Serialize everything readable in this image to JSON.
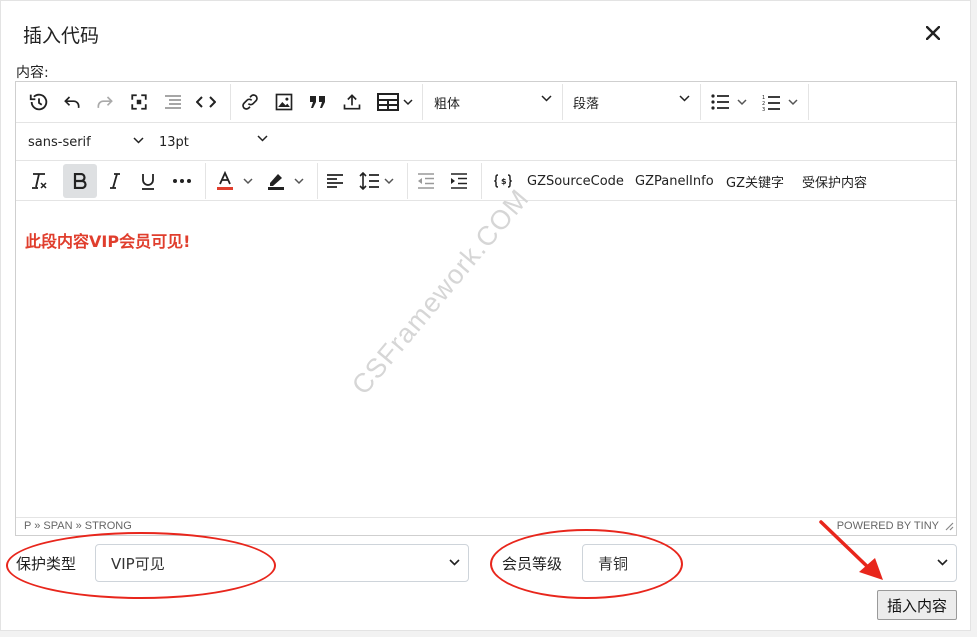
{
  "dialog": {
    "title": "插入代码",
    "close_icon": "close-icon"
  },
  "content_label": "内容:",
  "toolbar": {
    "row1": {
      "icons": [
        "history-icon",
        "undo-icon",
        "redo-icon",
        "fullscreen-icon",
        "indent-list-icon",
        "code-icon",
        "link-icon",
        "image-icon",
        "quote-icon",
        "upload-icon",
        "table-icon"
      ],
      "font_weight_select": "粗体",
      "block_format_select": "段落",
      "list_icons": [
        "bullet-list-icon",
        "numbered-list-icon"
      ]
    },
    "row2": {
      "font_family_select": "sans-serif",
      "font_size_select": "13pt"
    },
    "row3": {
      "icons": [
        "clear-format-icon",
        "bold-icon",
        "italic-icon",
        "underline-icon",
        "more-icon",
        "text-color-icon",
        "highlight-icon",
        "align-left-icon",
        "line-height-icon",
        "outdent-icon",
        "indent-icon",
        "variable-icon"
      ],
      "text_color": "#e03e2d",
      "custom_buttons": [
        "GZSourceCode",
        "GZPanelInfo",
        "GZ关键字",
        "受保护内容"
      ]
    }
  },
  "editor": {
    "content": "此段内容VIP会员可见!",
    "content_color": "#e03e2d",
    "watermark": "CSFramework.COM",
    "status_path": "P » SPAN » STRONG",
    "powered_by": "POWERED BY TINY"
  },
  "form": {
    "protect_type_label": "保护类型",
    "protect_type_value": "VIP可见",
    "member_level_label": "会员等级",
    "member_level_value": "青铜"
  },
  "insert_button": "插入内容",
  "annotation_color": "#e8261c"
}
